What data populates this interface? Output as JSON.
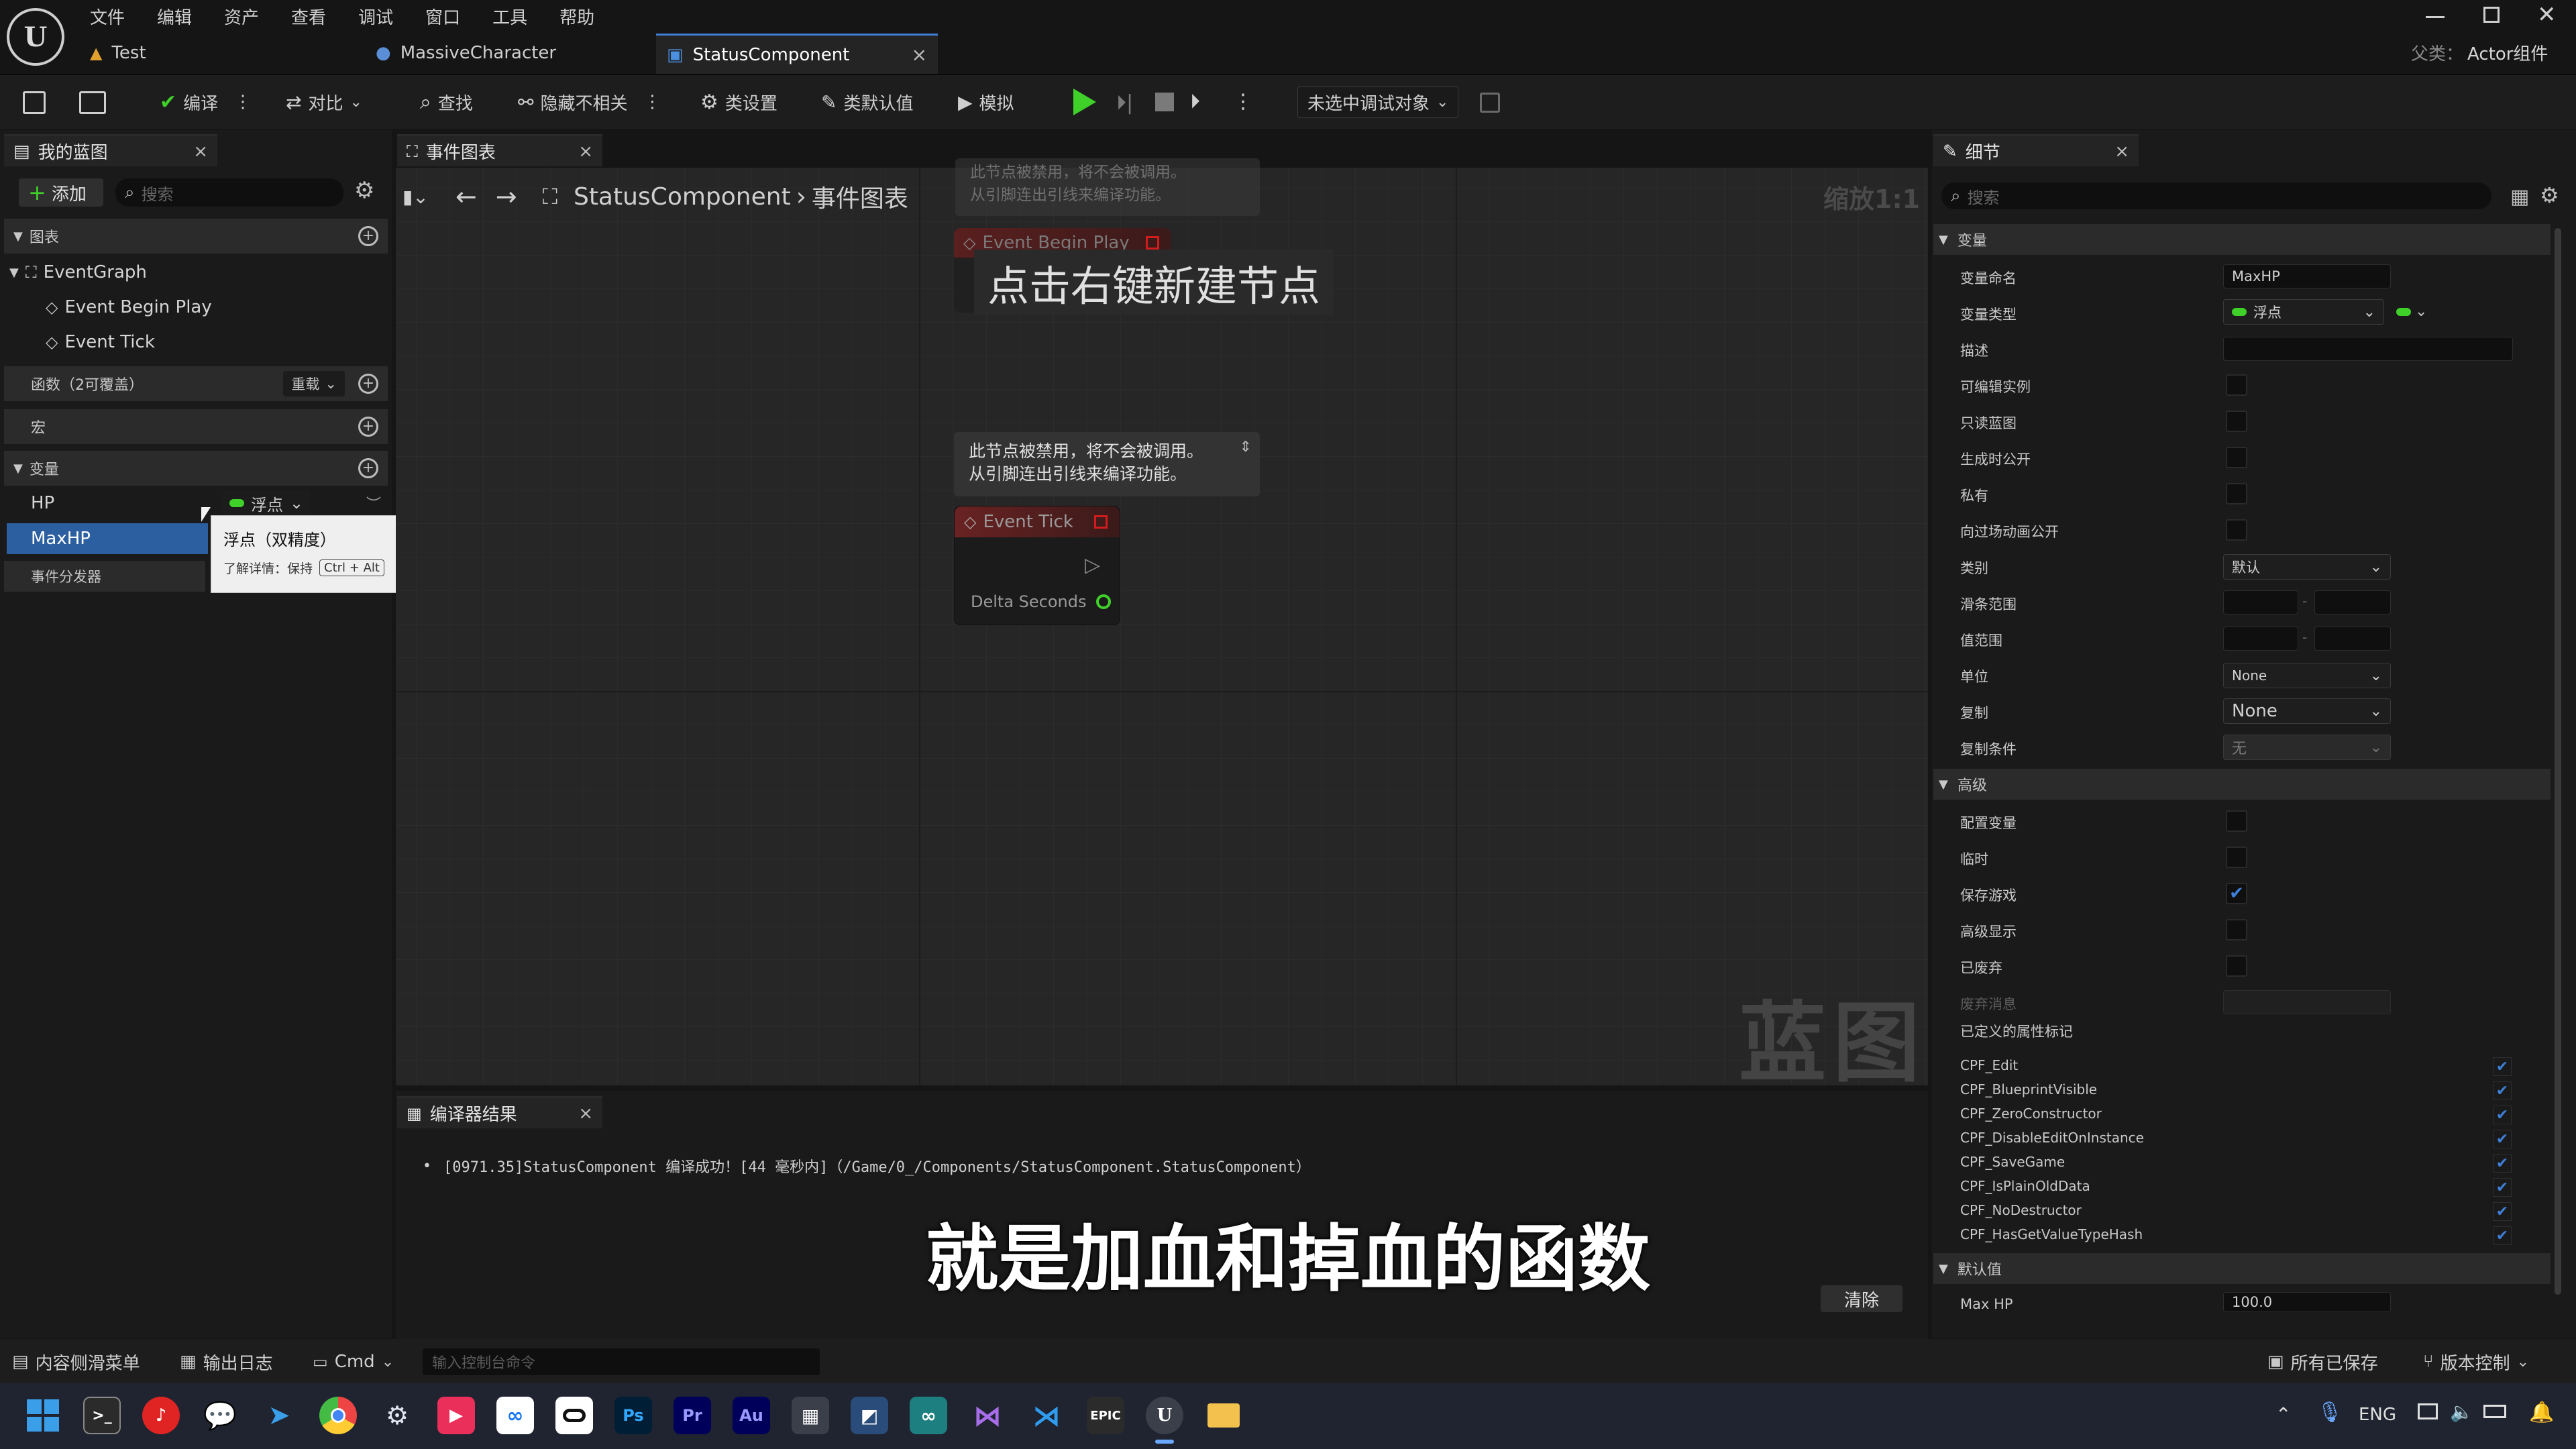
{
  "menu": [
    "文件",
    "编辑",
    "资产",
    "查看",
    "调试",
    "窗口",
    "工具",
    "帮助"
  ],
  "doc_tabs": [
    {
      "label": "Test"
    },
    {
      "label": "MassiveCharacter"
    },
    {
      "label": "StatusComponent",
      "close": "×"
    }
  ],
  "parent_class": {
    "label": "父类：",
    "value": "Actor组件"
  },
  "toolbar": {
    "compile": "编译",
    "diff": "对比",
    "find": "查找",
    "hide_unrelated": "隐藏不相关",
    "class_settings": "类设置",
    "class_defaults": "类默认值",
    "simulate": "模拟",
    "debug_target": "未选中调试对象"
  },
  "my_blueprint": {
    "tab": "我的蓝图",
    "add": "添加",
    "search_placeholder": "搜索",
    "graphs_header": "图表",
    "event_graph": "EventGraph",
    "events": [
      "Event Begin Play",
      "Event Tick"
    ],
    "functions_header": "函数（2可覆盖）",
    "override": "重载",
    "macros_header": "宏",
    "variables_header": "变量",
    "variables": [
      {
        "name": "HP",
        "type": "浮点"
      },
      {
        "name": "MaxHP"
      }
    ],
    "dispatchers": "事件分发器",
    "tooltip": {
      "title": "浮点（双精度）",
      "hint": "了解详情：保持",
      "shortcut": "Ctrl + Alt"
    }
  },
  "graph": {
    "tab": "事件图表",
    "breadcrumb_root": "StatusComponent",
    "breadcrumb_sep": "›",
    "breadcrumb_leaf": "事件图表",
    "zoom": "缩放1:1",
    "hint": "点击右键新建节点",
    "disabled_note_top": "此节点被禁用，将不会被调用。\n从引脚连出引线来编译功能。",
    "disabled_note": "此节点被禁用，将不会被调用。\n从引脚连出引线来编译功能。",
    "node_begin": "Event Begin Play",
    "node_tick": "Event Tick",
    "pin_delta": "Delta Seconds",
    "watermark": "蓝图"
  },
  "compiler": {
    "tab": "编译器结果",
    "message": "[0971.35]StatusComponent 编译成功！[44 毫秒内]（/Game/0_/Components/StatusComponent.StatusComponent）",
    "clear": "清除"
  },
  "subtitle": "就是加血和掉血的函数",
  "details": {
    "tab": "细节",
    "search_placeholder": "搜索",
    "variable_section": "变量",
    "rows": [
      {
        "label": "变量命名",
        "value": "MaxHP"
      },
      {
        "label": "变量类型",
        "value": "浮点"
      },
      {
        "label": "描述"
      },
      {
        "label": "可编辑实例"
      },
      {
        "label": "只读蓝图"
      },
      {
        "label": "生成时公开"
      },
      {
        "label": "私有"
      },
      {
        "label": "向过场动画公开"
      },
      {
        "label": "类别",
        "value": "默认"
      },
      {
        "label": "滑条范围",
        "sep": "-"
      },
      {
        "label": "值范围",
        "sep": "-"
      },
      {
        "label": "单位",
        "value": "None"
      },
      {
        "label": "复制",
        "value": "None"
      },
      {
        "label": "复制条件",
        "value": "无"
      }
    ],
    "advanced_section": "高级",
    "advanced_rows": [
      {
        "label": "配置变量",
        "checked": false
      },
      {
        "label": "临时",
        "checked": false
      },
      {
        "label": "保存游戏",
        "checked": true
      },
      {
        "label": "高级显示",
        "checked": false
      },
      {
        "label": "已废弃",
        "checked": false
      }
    ],
    "deprecation_msg": "废弃消息",
    "defined_flags": "已定义的属性标记",
    "cpf_flags": [
      "CPF_Edit",
      "CPF_BlueprintVisible",
      "CPF_ZeroConstructor",
      "CPF_DisableEditOnInstance",
      "CPF_SaveGame",
      "CPF_IsPlainOldData",
      "CPF_NoDestructor",
      "CPF_HasGetValueTypeHash"
    ],
    "default_section": "默认值",
    "default_label": "Max HP",
    "default_value": "100.0"
  },
  "statusbar": {
    "content_drawer": "内容侧滑菜单",
    "output_log": "输出日志",
    "cmd": "Cmd",
    "console_placeholder": "输入控制台命令",
    "all_saved": "所有已保存",
    "source_control": "版本控制"
  },
  "taskbar": {
    "lang": "ENG",
    "icons": [
      "windows-start",
      "terminal",
      "netease-music",
      "wechat",
      "lark",
      "chrome",
      "steam",
      "app-red",
      "meta",
      "oculus",
      "photoshop",
      "premiere",
      "audition",
      "calculator",
      "app-blue",
      "app-teal",
      "visual-studio",
      "vscode",
      "epic-games",
      "unreal-engine",
      "file-explorer"
    ],
    "tray_icons": [
      "chevron-up-icon",
      "mic-icon",
      "monitor-icon",
      "speaker-icon",
      "battery-icon",
      "notification-icon"
    ]
  },
  "colors": {
    "accent_green": "#3fd12a",
    "accent_blue": "#3d7fd9",
    "node_red": "#d01c1c",
    "bg": "#151515"
  }
}
